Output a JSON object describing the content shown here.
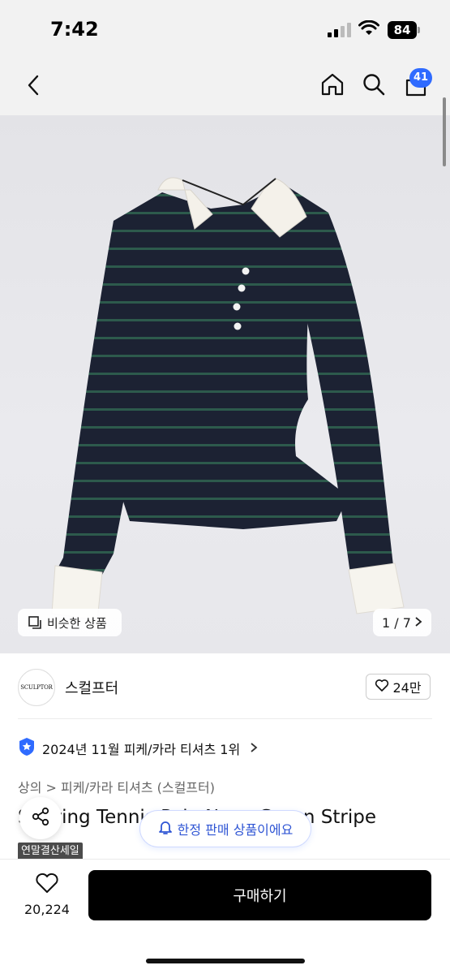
{
  "status_bar": {
    "time": "7:42",
    "battery": "84"
  },
  "nav": {
    "cart_count": "41"
  },
  "gallery": {
    "similar_label": "비슷한 상품",
    "counter": "1 / 7",
    "image_icon": "product-photo-striped-polo"
  },
  "brand": {
    "logo_text": "SCULPTOR",
    "name": "스컬프터",
    "likes": "24만"
  },
  "ranking": {
    "text": "2024년 11월 피케/카라 티셔츠 1위"
  },
  "breadcrumb": "상의 > 피케/카라 티셔츠 (스컬프터)",
  "product": {
    "title": "Shirring Tennis Polo Navy Green Stripe",
    "limited_notice": "한정 판매 상품이에요",
    "sale_tag": "연말결산세일"
  },
  "bottom": {
    "wish_count": "20,224",
    "buy_label": "구매하기"
  },
  "colors": {
    "accent": "#2f6bff",
    "buy_button": "#000000",
    "sale_tag": "#4b4b4b"
  }
}
